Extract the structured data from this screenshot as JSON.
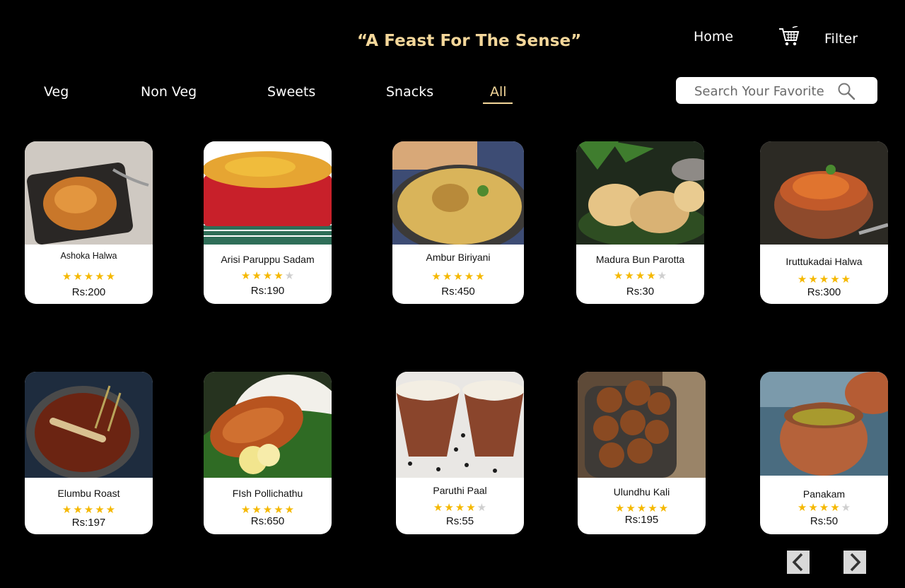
{
  "header": {
    "tagline": "“A Feast For The Sense”",
    "nav": {
      "home": "Home",
      "filter": "Filter"
    }
  },
  "categories": [
    "Veg",
    "Non Veg",
    "Sweets",
    "Snacks",
    "All"
  ],
  "active_category": "All",
  "search": {
    "placeholder": "Search Your Favorite",
    "value": ""
  },
  "colors": {
    "accent": "#f4d79a",
    "star": "#f5b800",
    "star_off": "#cfcfcf",
    "background": "#000000"
  },
  "products": [
    {
      "name": "Ashoka Halwa",
      "rating": 5,
      "price": "Rs:200"
    },
    {
      "name": "Arisi Paruppu Sadam",
      "rating": 4,
      "price": "Rs:190"
    },
    {
      "name": "Ambur Biriyani",
      "rating": 5,
      "price": "Rs:450"
    },
    {
      "name": "Madura Bun Parotta",
      "rating": 4,
      "price": "Rs:30"
    },
    {
      "name": "Iruttukadai Halwa",
      "rating": 5,
      "price": "Rs:300"
    },
    {
      "name": "Elumbu Roast",
      "rating": 5,
      "price": "Rs:197"
    },
    {
      "name": "FIsh Pollichathu",
      "rating": 5,
      "price": "Rs:650"
    },
    {
      "name": "Paruthi Paal",
      "rating": 4,
      "price": "Rs:55"
    },
    {
      "name": "Ulundhu Kali",
      "rating": 5,
      "price": "Rs:195"
    },
    {
      "name": "Panakam",
      "rating": 4,
      "price": "Rs:50"
    }
  ],
  "pagination": {
    "prev_icon": "chevron-left-icon",
    "next_icon": "chevron-right-icon"
  }
}
